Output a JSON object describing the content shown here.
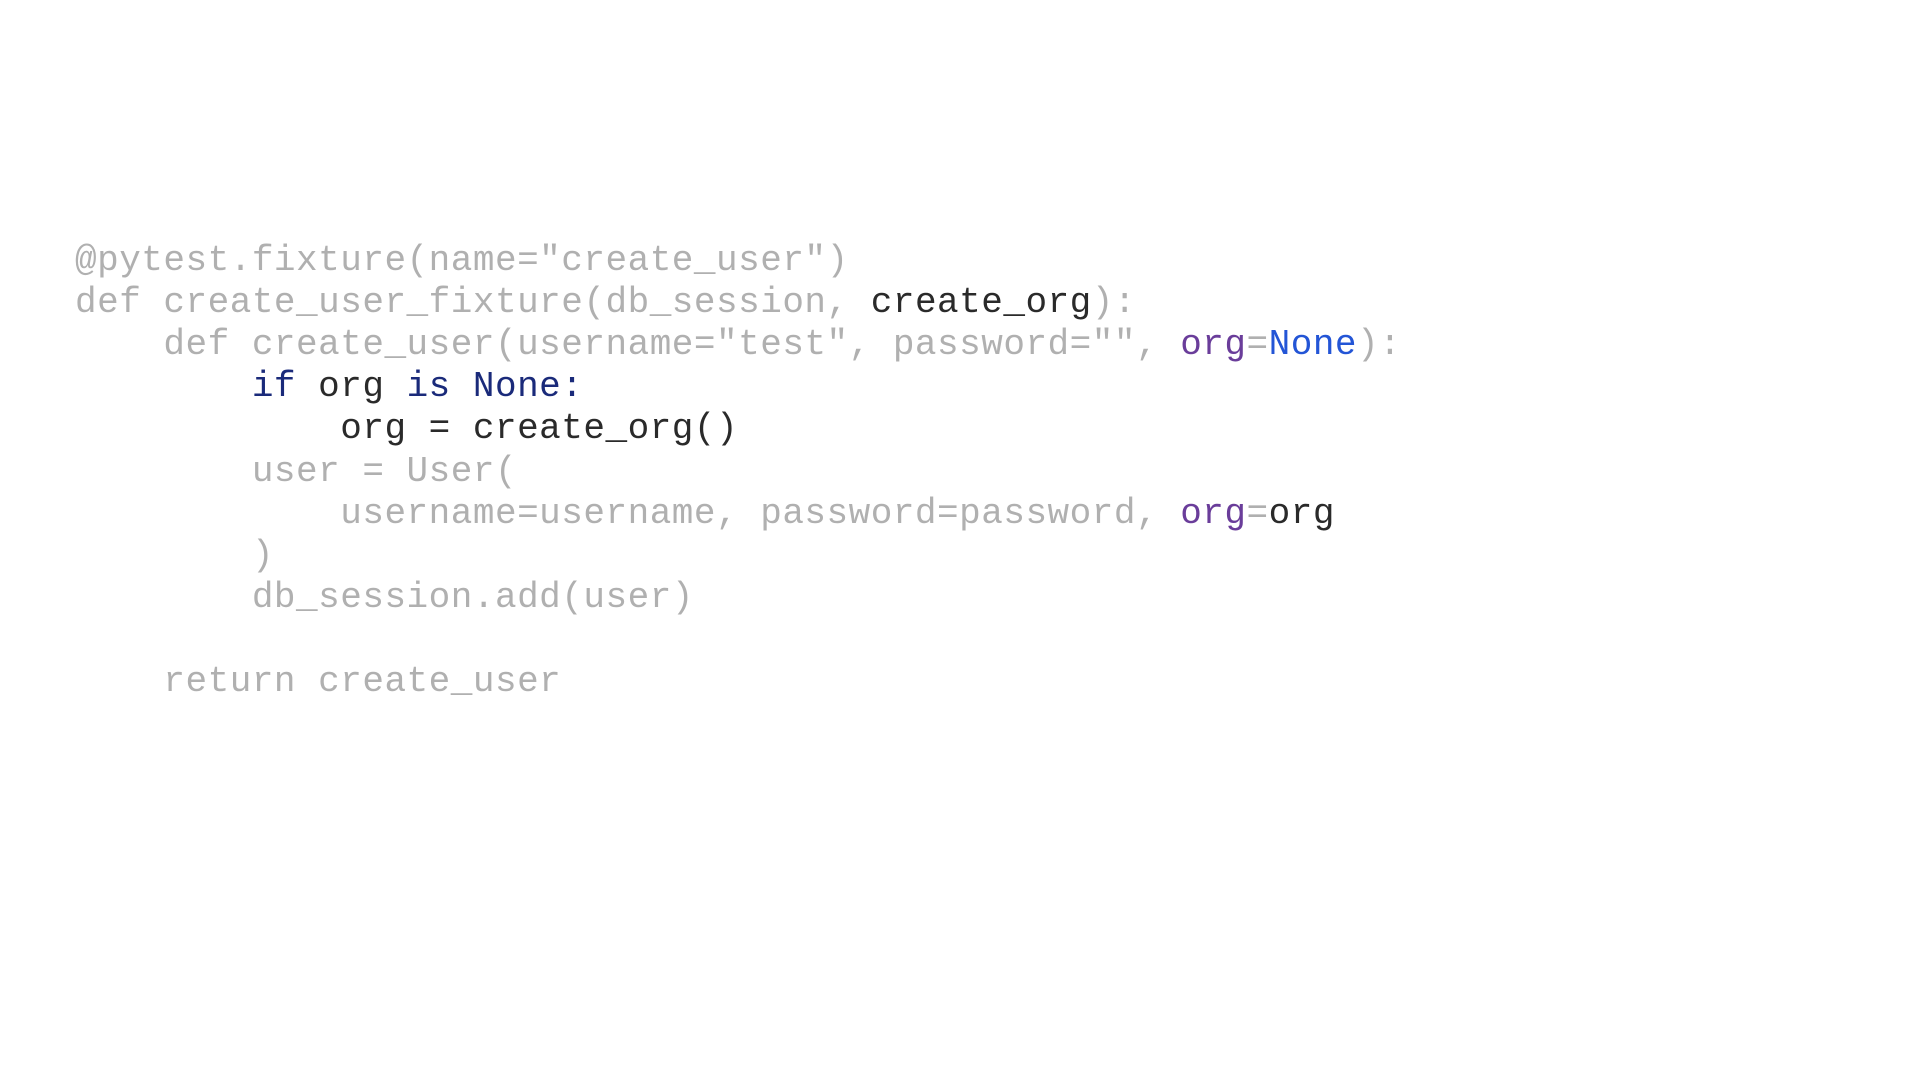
{
  "code": {
    "l1": {
      "a": "@pytest.fixture(name=\"create_user\")"
    },
    "l2": {
      "a": "def create_user_fixture(db_session, ",
      "b": "create_org",
      "c": "):"
    },
    "l3": {
      "a": "    def create_user(username=\"test\", password=\"\", ",
      "b": "org",
      "c": "=",
      "d": "None",
      "e": "):"
    },
    "l4": {
      "a": "        ",
      "b": "if ",
      "c": "org ",
      "d": "is ",
      "e": "None:"
    },
    "l5": {
      "a": "            ",
      "b": "org = create_org()"
    },
    "l6": {
      "a": "        user = User("
    },
    "l7": {
      "a": "            username=username, password=password, ",
      "b": "org",
      "c": "=",
      "d": "org"
    },
    "l8": {
      "a": "        )"
    },
    "l9": {
      "a": "        db_session.add(user)"
    },
    "l10": {
      "a": ""
    },
    "l11": {
      "a": "    return create_user"
    }
  }
}
